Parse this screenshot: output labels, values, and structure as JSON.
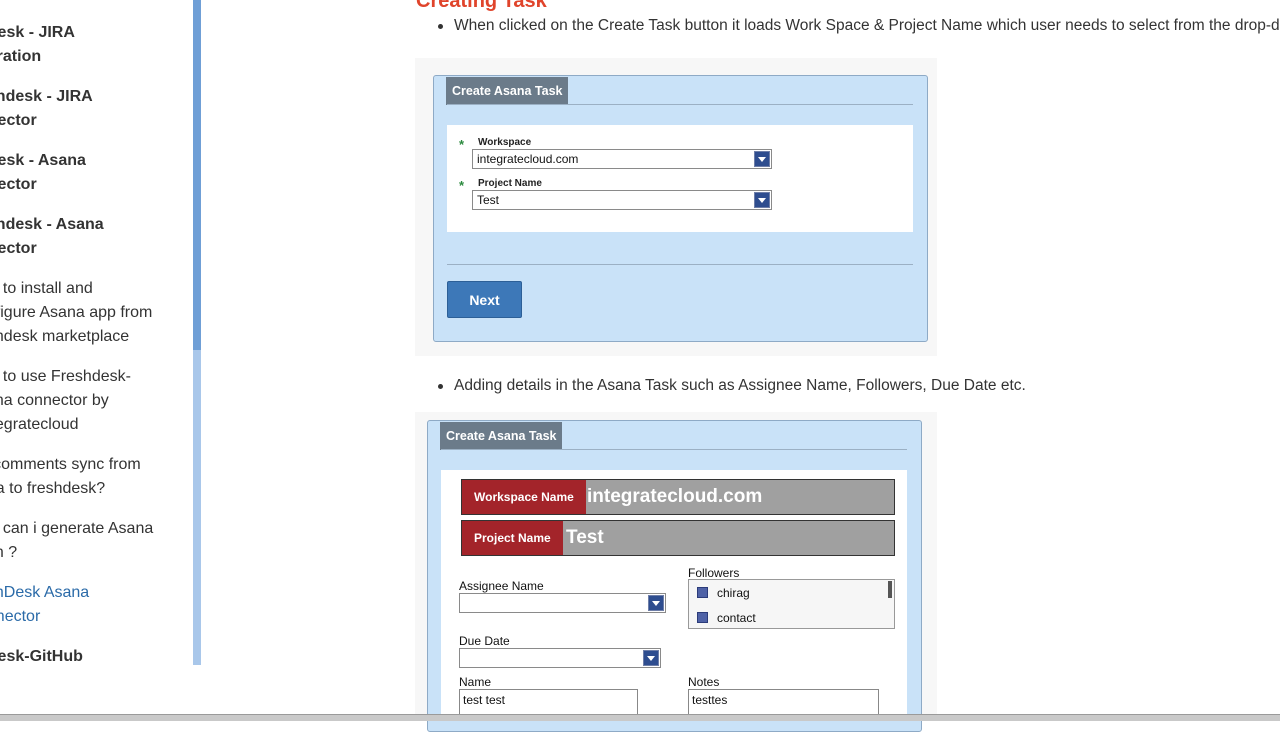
{
  "sidebar": {
    "items": [
      {
        "label": "ndesk - JIRA",
        "label2": "egration",
        "bold": true
      },
      {
        "label": "eshdesk - JIRA",
        "label2": "nnector",
        "bold": true
      },
      {
        "label": "ndesk - Asana",
        "label2": "nnector",
        "bold": true
      },
      {
        "label": "eshdesk - Asana",
        "label2": "nnector",
        "bold": true
      },
      {
        "label": "ow to install and",
        "label2": "onfigure Asana app from",
        "label3": "eshdesk marketplace",
        "bold": false
      },
      {
        "label": "ow to use Freshdesk-",
        "label2": "sana connector by",
        "label3": "integratecloud",
        "bold": false
      },
      {
        "label": "ill comments sync from",
        "label2": "ana to freshdesk?",
        "bold": false
      },
      {
        "label": "ow can i generate Asana",
        "label2": "ken ?",
        "bold": false
      },
      {
        "label": "eshDesk Asana",
        "label2": "onnector",
        "bold": false,
        "active": true
      },
      {
        "label": "ndesk-GitHub",
        "bold": true
      }
    ]
  },
  "main": {
    "heading": "Creating Task",
    "bullet1": "When clicked on the Create Task button it loads Work Space & Project Name which user needs to select from the drop-d",
    "bullet2": "Adding details in the Asana Task such as Assignee Name, Followers, Due Date etc."
  },
  "screenshot1": {
    "tab": "Create Asana Task",
    "workspace_label": "Workspace",
    "workspace_value": "integratecloud.com",
    "project_label": "Project Name",
    "project_value": "Test",
    "required_marker": "*",
    "next_label": "Next"
  },
  "screenshot2": {
    "tab": "Create Asana Task",
    "workspace_name_key": "Workspace Name",
    "workspace_name_value": "integratecloud.com",
    "project_name_key": "Project Name",
    "project_name_value": "Test",
    "assignee_label": "Assignee Name",
    "assignee_value": "",
    "followers_label": "Followers",
    "followers": [
      "chirag",
      "contact"
    ],
    "due_date_label": "Due Date",
    "due_date_value": "",
    "name_label": "Name",
    "name_value": "test test",
    "notes_label": "Notes",
    "notes_value": "testtes"
  },
  "colors": {
    "heading": "#e0442b",
    "panel_bg": "#c9e2f8",
    "accent_blue": "#3d78b8",
    "label_red": "#a3242a"
  }
}
